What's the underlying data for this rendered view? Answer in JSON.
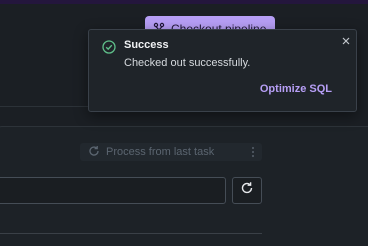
{
  "header": {
    "pipeline_button_label": "Checkout pipeline"
  },
  "panel": {
    "action_label": "Process from last task"
  },
  "toast": {
    "title": "Success",
    "message": "Checked out successfully.",
    "action_label": "Optimize SQL"
  },
  "colors": {
    "accent": "#b79ff6",
    "success": "#5fbf8a",
    "background": "#1b1f24"
  },
  "icons": [
    "pipeline-icon",
    "success-check-icon",
    "close-icon",
    "refresh-icon",
    "more-vertical-icon"
  ]
}
